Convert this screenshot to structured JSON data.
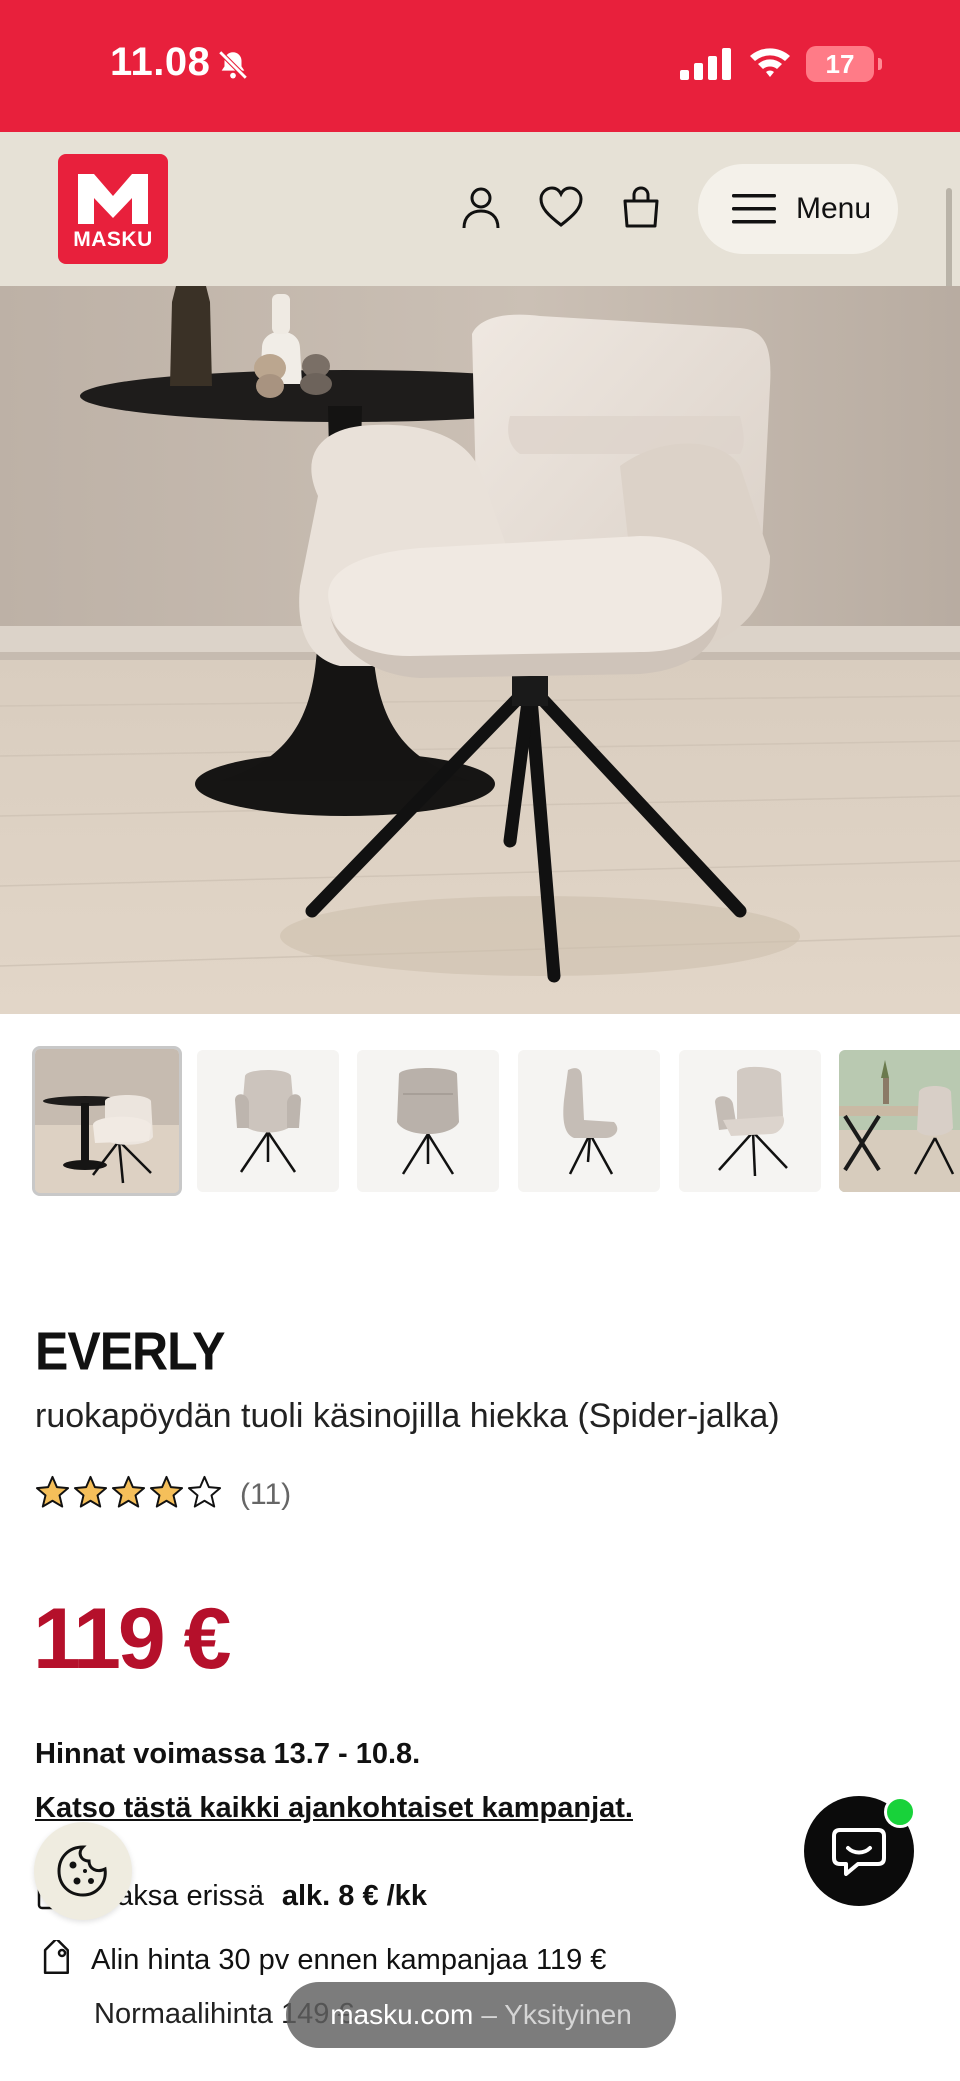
{
  "status_bar": {
    "time": "11.08",
    "battery": "17"
  },
  "header": {
    "logo_text": "MASKU",
    "menu_label": "Menu"
  },
  "product": {
    "brand": "EVERLY",
    "subtitle": "ruokapöydän tuoli käsinojilla hiekka (Spider-jalka)",
    "rating": 4,
    "rating_max": 5,
    "review_count": "(11)",
    "price": "119 €",
    "valid_text": "Hinnat voimassa 13.7 - 10.8.",
    "campaign_link": "Katso tästä kaikki ajankohtaiset kampanjat.",
    "installment_text": "Maksa erissä",
    "installment_amount": "alk. 8 € /kk",
    "lowest_price_text": "Alin hinta 30 pv ennen kampanjaa 119 €",
    "normal_price_text": "Normaalihinta 149 €"
  },
  "thumbnails": [
    "lifestyle",
    "front",
    "back",
    "side",
    "angle",
    "dining"
  ],
  "browser": {
    "domain": "masku.com",
    "mode": "– Yksityinen"
  },
  "colors": {
    "brand_red": "#e8203c",
    "price_red": "#b5102b",
    "header_bg": "#e6e1d6",
    "chat_online": "#18d23a"
  }
}
